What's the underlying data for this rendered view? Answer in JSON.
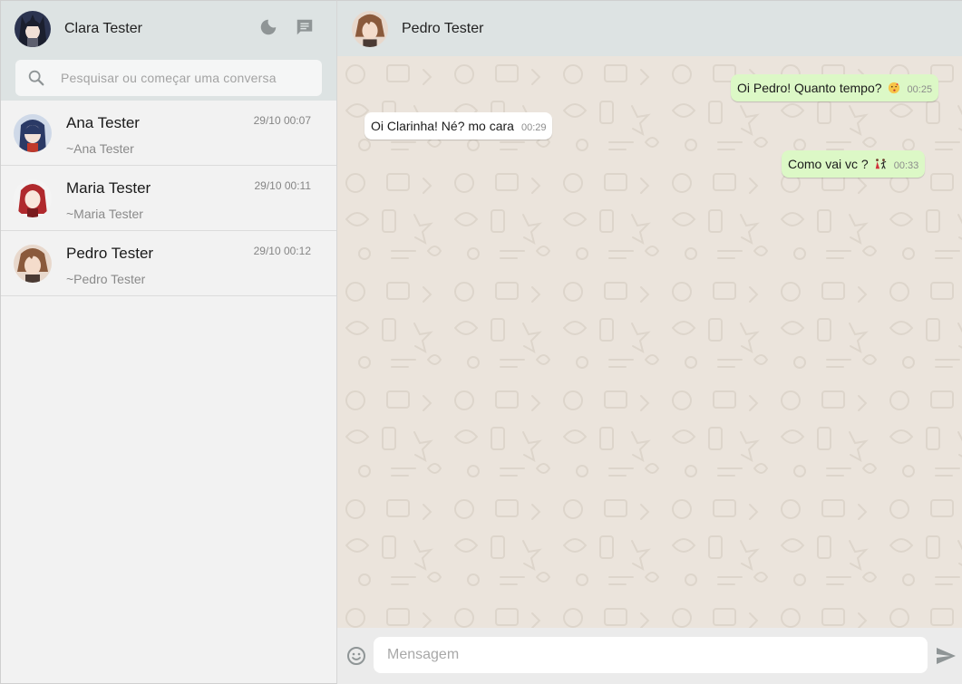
{
  "me": {
    "name": "Clara Tester",
    "avatar": "clara-avatar"
  },
  "header_icons": [
    "moon-icon",
    "new-chat-icon"
  ],
  "search": {
    "placeholder": "Pesquisar ou começar uma conversa"
  },
  "chats": [
    {
      "name": "Ana Tester",
      "subtitle": "~Ana Tester",
      "time": "29/10 00:07",
      "avatar": "ana-avatar"
    },
    {
      "name": "Maria Tester",
      "subtitle": "~Maria Tester",
      "time": "29/10 00:11",
      "avatar": "maria-avatar"
    },
    {
      "name": "Pedro Tester",
      "subtitle": "~Pedro Tester",
      "time": "29/10 00:12",
      "avatar": "pedro-avatar"
    }
  ],
  "active_chat": {
    "name": "Pedro Tester",
    "avatar": "pedro-avatar"
  },
  "messages": [
    {
      "direction": "out",
      "text": "Oi Pedro! Quanto tempo?",
      "emoji": "kiss-emoji",
      "time": "00:25"
    },
    {
      "direction": "in",
      "text": "Oi Clarinha! Né? mo cara",
      "time": "00:29"
    },
    {
      "direction": "out",
      "text": "Como vai vc ?",
      "emoji": "dancers-emoji",
      "time": "00:33"
    }
  ],
  "composer": {
    "placeholder": "Mensagem",
    "emoji_icon": "smiley-icon",
    "send_icon": "send-icon"
  },
  "colors": {
    "header_bg": "#dde3e3",
    "sidebar_bg": "#f2f2f2",
    "chat_bg": "#ebe4dc",
    "outgoing_bubble": "#dcf8c6",
    "incoming_bubble": "#ffffff"
  }
}
